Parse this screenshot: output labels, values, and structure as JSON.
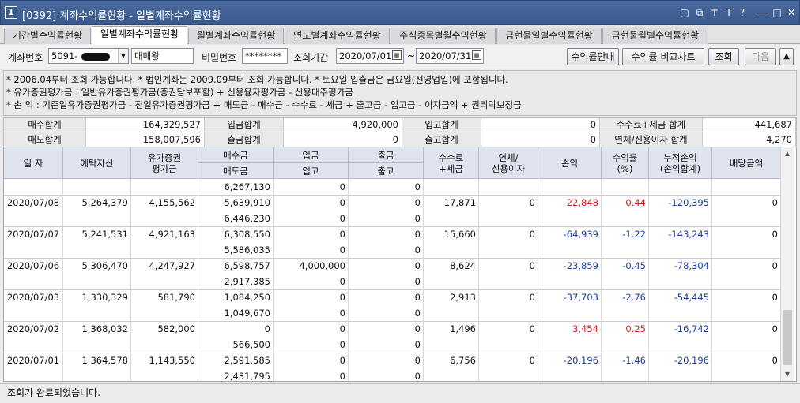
{
  "window": {
    "number": "1",
    "title": "[0392] 계좌수익률현황 - 일별계좌수익률현황",
    "controls": [
      "▢",
      "⧉",
      "₸",
      "T",
      "?",
      "—",
      "□",
      "✕"
    ]
  },
  "tabs": [
    {
      "label": "기간별수익률현황",
      "active": false
    },
    {
      "label": "일별계좌수익률현황",
      "active": true
    },
    {
      "label": "월별계좌수익률현황",
      "active": false
    },
    {
      "label": "연도별계좌수익률현황",
      "active": false
    },
    {
      "label": "주식종목별월수익현황",
      "active": false
    },
    {
      "label": "금현물일별수익률현황",
      "active": false
    },
    {
      "label": "금현물월별수익률현황",
      "active": false
    }
  ],
  "query": {
    "account_label": "계좌번호",
    "account_value": "5091-",
    "account_name": "매매왕",
    "password_label": "비밀번호",
    "password_value": "********",
    "period_label": "조회기간",
    "date_from": "2020/07/01",
    "date_sep": "~",
    "date_to": "2020/07/31",
    "btn_guide": "수익률안내",
    "btn_compare": "수익률 비교차트",
    "btn_search": "조회",
    "btn_next": "다음",
    "btn_up": "▲"
  },
  "notes": [
    "* 2006.04부터 조회 가능합니다.   * 법인계좌는 2009.09부터 조회 가능합니다.   * 토요일 입출금은 금요일(전영업일)에 포함됩니다.",
    "* 유가증권평가금 : 일반유가증권평가금(증권담보포함) + 신용융자평가금 - 신용대주평가금",
    "* 손           익 : 기준일유가증권평가금 - 전일유가증권평가금 + 매도금 - 매수금 - 수수료 - 세금 + 출고금 - 입고금 - 이자금액 + 권리락보정금"
  ],
  "summary": {
    "buy_total_label": "매수합계",
    "buy_total": "164,329,527",
    "deposit_total_label": "입금합계",
    "deposit_total": "4,920,000",
    "in_stock_total_label": "입고합계",
    "in_stock_total": "0",
    "fee_tax_total_label": "수수료+세금 합계",
    "fee_tax_total": "441,687",
    "sell_total_label": "매도합계",
    "sell_total": "158,007,596",
    "withdraw_total_label": "출금합계",
    "withdraw_total": "0",
    "out_stock_total_label": "출고합계",
    "out_stock_total": "0",
    "interest_total_label": "연체/신용이자 합계",
    "interest_total": "4,270"
  },
  "grid": {
    "headers": {
      "date": "일 자",
      "deposit_asset": "예탁자산",
      "securities_eval": "유가증권\n평가금",
      "buy_amount": "매수금",
      "sell_amount": "매도금",
      "deposit": "입금",
      "in_stock": "입고",
      "withdraw": "출금",
      "out_stock": "출고",
      "fee_tax": "수수료\n+세금",
      "interest": "연체/\n신용이자",
      "profit": "손익",
      "return_rate": "수익률\n(%)",
      "cum_profit": "누적손익\n(손익합계)",
      "dividend": "배당금액"
    },
    "partial_row": {
      "sell_amount": "6,267,130",
      "in_stock": "0",
      "out_stock": "0"
    },
    "rows": [
      {
        "date": "2020/07/08",
        "deposit_asset": "5,264,379",
        "securities_eval": "4,155,562",
        "buy_amount": "5,639,910",
        "sell_amount": "6,446,230",
        "deposit": "0",
        "in_stock": "0",
        "withdraw": "0",
        "out_stock": "0",
        "fee_tax": "17,871",
        "interest": "0",
        "profit": "22,848",
        "return_rate": "0.44",
        "cum_profit": "-120,395",
        "dividend": "0"
      },
      {
        "date": "2020/07/07",
        "deposit_asset": "5,241,531",
        "securities_eval": "4,921,163",
        "buy_amount": "6,308,550",
        "sell_amount": "5,586,035",
        "deposit": "0",
        "in_stock": "0",
        "withdraw": "0",
        "out_stock": "0",
        "fee_tax": "15,660",
        "interest": "0",
        "profit": "-64,939",
        "return_rate": "-1.22",
        "cum_profit": "-143,243",
        "dividend": "0"
      },
      {
        "date": "2020/07/06",
        "deposit_asset": "5,306,470",
        "securities_eval": "4,247,927",
        "buy_amount": "6,598,757",
        "sell_amount": "2,917,385",
        "deposit": "4,000,000",
        "in_stock": "0",
        "withdraw": "0",
        "out_stock": "0",
        "fee_tax": "8,624",
        "interest": "0",
        "profit": "-23,859",
        "return_rate": "-0.45",
        "cum_profit": "-78,304",
        "dividend": "0"
      },
      {
        "date": "2020/07/03",
        "deposit_asset": "1,330,329",
        "securities_eval": "581,790",
        "buy_amount": "1,084,250",
        "sell_amount": "1,049,670",
        "deposit": "0",
        "in_stock": "0",
        "withdraw": "0",
        "out_stock": "0",
        "fee_tax": "2,913",
        "interest": "0",
        "profit": "-37,703",
        "return_rate": "-2.76",
        "cum_profit": "-54,445",
        "dividend": "0"
      },
      {
        "date": "2020/07/02",
        "deposit_asset": "1,368,032",
        "securities_eval": "582,000",
        "buy_amount": "0",
        "sell_amount": "566,500",
        "deposit": "0",
        "in_stock": "0",
        "withdraw": "0",
        "out_stock": "0",
        "fee_tax": "1,496",
        "interest": "0",
        "profit": "3,454",
        "return_rate": "0.25",
        "cum_profit": "-16,742",
        "dividend": "0"
      },
      {
        "date": "2020/07/01",
        "deposit_asset": "1,364,578",
        "securities_eval": "1,143,550",
        "buy_amount": "2,591,585",
        "sell_amount": "2,431,795",
        "deposit": "0",
        "in_stock": "0",
        "withdraw": "0",
        "out_stock": "0",
        "fee_tax": "6,756",
        "interest": "0",
        "profit": "-20,196",
        "return_rate": "-1.46",
        "cum_profit": "-20,196",
        "dividend": "0"
      }
    ]
  },
  "status": "조회가 완료되었습니다."
}
